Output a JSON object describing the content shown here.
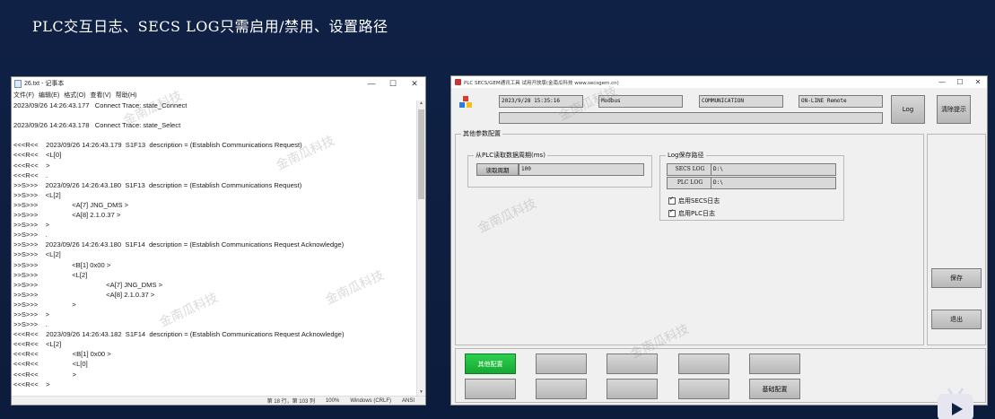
{
  "slide": {
    "title": "PLC交互日志、SECS LOG只需启用/禁用、设置路径"
  },
  "notepad": {
    "title": "26.txt - 记事本",
    "menu": [
      "文件(F)",
      "编辑(E)",
      "格式(O)",
      "查看(V)",
      "帮助(H)"
    ],
    "lines": [
      "2023/09/26 14:26:43.177   Connect Trace: state_Connect",
      "",
      "2023/09/26 14:26:43.178   Connect Trace: state_Select",
      "",
      "<<<R<<    2023/09/26 14:26:43.179  S1F13  description = (Establish Communications Request)",
      "<<<R<<    <L[0]",
      "<<<R<<    >",
      "<<<R<<    .",
      ">>S>>>    2023/09/26 14:26:43.180  S1F13  description = (Establish Communications Request)",
      ">>S>>>    <L[2]",
      ">>S>>>                  <A[7] JNG_DMS >",
      ">>S>>>                  <A[8] 2.1.0.37 >",
      ">>S>>>    >",
      ">>S>>>    .",
      ">>S>>>    2023/09/26 14:26:43.180  S1F14  description = (Establish Communications Request Acknowledge)",
      ">>S>>>    <L[2]",
      ">>S>>>                  <B[1] 0x00 >",
      ">>S>>>                  <L[2]",
      ">>S>>>                                    <A[7] JNG_DMS >",
      ">>S>>>                                    <A[8] 2.1.0.37 >",
      ">>S>>>                  >",
      ">>S>>>    >",
      ">>S>>>    .",
      "<<<R<<    2023/09/26 14:26:43.182  S1F14  description = (Establish Communications Request Acknowledge)",
      "<<<R<<    <L[2]",
      "<<<R<<                  <B[1] 0x00 >",
      "<<<R<<                  <L[0]",
      "<<<R<<                  >",
      "<<<R<<    >"
    ],
    "status": {
      "position": "第 18 行，第 103 列",
      "zoom": "100%",
      "eol": "Windows (CRLF)",
      "encoding": "ANSI"
    }
  },
  "plc_tool": {
    "title": "PLC SECS/GEM通讯工具 试用开放版(金南瓜科技 www.secsgem.cn)",
    "datetime": "2023/9/28 15:35:16",
    "protocol": "Modbus",
    "comm_state": "COMMUNICATION",
    "control_state": "ON-LINE Remote",
    "log_button": "Log",
    "clear_button": "清除提示",
    "section_title": "其他参数配置",
    "read_group": {
      "title": "从PLC读取数据周期(ms)",
      "button": "读取周期",
      "value": "100"
    },
    "log_group": {
      "title": "Log保存路径",
      "secs_label": "SECS LOG",
      "secs_path": "D:\\",
      "plc_label": "PLC LOG",
      "plc_path": "D:\\",
      "enable_secs": "启用SECS日志",
      "enable_plc": "启用PLC日志"
    },
    "save_button": "保存",
    "exit_button": "退出",
    "nav": {
      "other_config": "其他配置",
      "basic_config": "基础配置"
    }
  },
  "watermarks": [
    "金南瓜科技",
    "金南瓜科技",
    "金南瓜科技",
    "金南瓜科技",
    "金南瓜科技",
    "金南瓜科技",
    "金南瓜科技"
  ]
}
